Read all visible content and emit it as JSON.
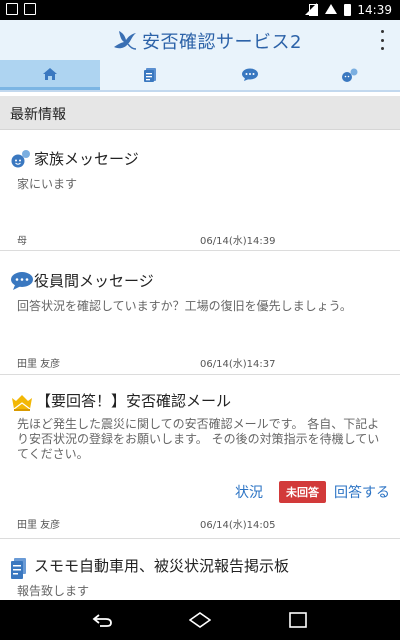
{
  "status_bar": {
    "time": "14:39"
  },
  "header": {
    "app_title": "安否確認サービス2"
  },
  "tabs": [
    {
      "icon": "home-icon",
      "active": true
    },
    {
      "icon": "document-icon",
      "active": false
    },
    {
      "icon": "chat-icon",
      "active": false
    },
    {
      "icon": "family-icon",
      "active": false
    }
  ],
  "section": {
    "title": "最新情報"
  },
  "feed": [
    {
      "icon": "family-message-icon",
      "title": "家族メッセージ",
      "body": "家にいます",
      "sender": "母",
      "datetime": "06/14(水)14:39"
    },
    {
      "icon": "chat-bubble-icon",
      "title": "役員間メッセージ",
      "body": "回答状況を確認していますか？工場の復旧を優先しましょう。",
      "sender": "田里 友彦",
      "datetime": "06/14(水)14:37"
    },
    {
      "icon": "crown-mail-icon",
      "title": "【要回答！】安否確認メール",
      "body": "先ほど発生した震災に関しての安否確認メールです。 各自、下記より安否状況の登録をお願いします。 その後の対策指示を待機していてください。",
      "status_link": "状況",
      "badge": "未回答",
      "answer_link": "回答する",
      "sender": "田里 友彦",
      "datetime": "06/14(水)14:05"
    },
    {
      "icon": "clipboard-icon",
      "title": "スモモ自動車用、被災状況報告掲示板",
      "body": "報告致します"
    }
  ],
  "colors": {
    "accent": "#2c62a8",
    "header_bg": "#e9f3fb",
    "tab_active": "#aed4f1",
    "badge": "#d23a3a",
    "link": "#2b73c4"
  }
}
